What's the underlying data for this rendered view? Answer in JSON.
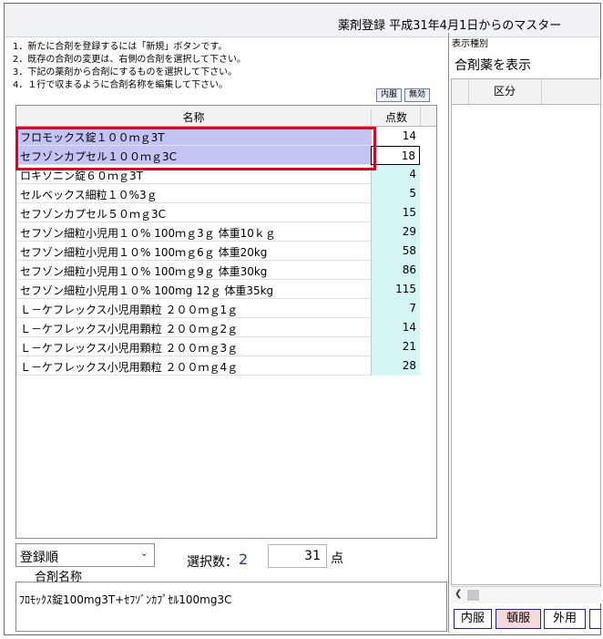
{
  "window": {
    "title": "薬剤登録  平成31年4月1日からのマスター"
  },
  "instructions": [
    "1．新たに合剤を登録するには「新規」ボタンです。",
    "2．既存の合剤の変更は、右側の合剤を選択して下さい。",
    "3．下記の薬剤から合剤にするものを選択して下さい。",
    "4．１行で収まるように合剤名称を編集して下さい。"
  ],
  "buttons": {
    "naifuku_small": "内服",
    "muko_small": "無効"
  },
  "grid": {
    "headers": {
      "name": "名称",
      "points": "点数"
    },
    "rows": [
      {
        "name": "フロモックス錠１００ｍｇ3T",
        "points": "14",
        "selected": true
      },
      {
        "name": "セフゾンカプセル１００ｍｇ3C",
        "points": "18",
        "selected": true
      },
      {
        "name": "ロキソニン錠６０ｍｇ3T",
        "points": "4",
        "selected": false
      },
      {
        "name": "セルベックス細粒１０%3ｇ",
        "points": "5",
        "selected": false
      },
      {
        "name": "セフゾンカプセル５０ｍｇ3C",
        "points": "15",
        "selected": false
      },
      {
        "name": "セフゾン細粒小児用１０%  100ｍｇ3ｇ  体重10ｋｇ",
        "points": "29",
        "selected": false
      },
      {
        "name": "セフゾン細粒小児用１０%  100ｍｇ6ｇ  体重20kg",
        "points": "58",
        "selected": false
      },
      {
        "name": "セフゾン細粒小児用１０%  100ｍｇ9ｇ  体重30kg",
        "points": "86",
        "selected": false
      },
      {
        "name": "セフゾン細粒小児用１０%  100mg 12ｇ  体重35kg",
        "points": "115",
        "selected": false
      },
      {
        "name": "Ｌ－ケフレックス小児用顆粒  ２００ｍｇ1ｇ",
        "points": "7",
        "selected": false
      },
      {
        "name": "Ｌ－ケフレックス小児用顆粒  ２００ｍｇ2ｇ",
        "points": "14",
        "selected": false
      },
      {
        "name": "Ｌ－ケフレックス小児用顆粒  ２００ｍｇ3ｇ",
        "points": "21",
        "selected": false
      },
      {
        "name": "Ｌ－ケフレックス小児用顆粒  ２００ｍｇ4ｇ",
        "points": "28",
        "selected": false
      }
    ]
  },
  "bottom": {
    "sort_value": "登録順",
    "selection_label": "選択数：",
    "selection_count": "2",
    "points_total": "31",
    "points_unit": "点",
    "mix_name_label": "合剤名称",
    "mix_name_value": "ﾌﾛﾓｯｸｽ錠100mg3T+ｾﾌｿﾞﾝｶﾌﾟｾﾙ100mg3C"
  },
  "right_panel": {
    "display_type_label": "表示種別",
    "display_type_value": "合剤薬を表示",
    "column_header": "区分",
    "category_buttons": [
      "内服",
      "頓服",
      "外用"
    ]
  },
  "colors": {
    "selected_row": "#c4c4f4",
    "points_cell": "#d6f5f5",
    "highlight_border": "#e1001f",
    "count_text": "#1f3a9a",
    "tonpuku_bg": "#f7d9d9"
  }
}
